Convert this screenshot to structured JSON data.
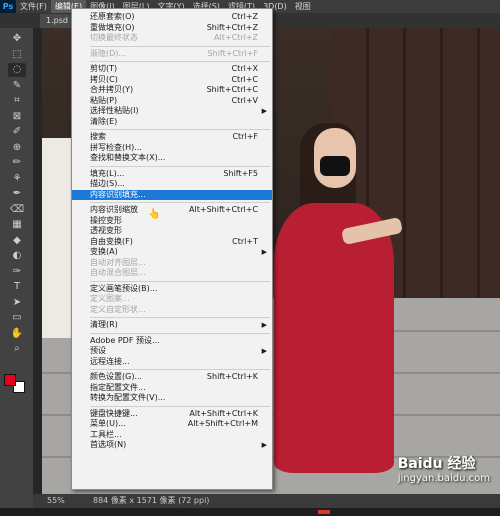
{
  "app": {
    "logo": "Ps"
  },
  "menubar": [
    {
      "label": "文件(F)",
      "active": false
    },
    {
      "label": "编辑(E)",
      "active": true
    },
    {
      "label": "图像(I)",
      "active": false
    },
    {
      "label": "图层(L)",
      "active": false
    },
    {
      "label": "文字(Y)",
      "active": false
    },
    {
      "label": "选择(S)",
      "active": false
    },
    {
      "label": "滤镜(T)",
      "active": false
    },
    {
      "label": "3D(D)",
      "active": false
    },
    {
      "label": "视图",
      "active": false
    }
  ],
  "document": {
    "tab": "1.psd"
  },
  "tools": [
    "move-icon",
    "marquee-icon",
    "lasso-icon",
    "quick-select-icon",
    "crop-icon",
    "frame-icon",
    "eyedropper-icon",
    "healing-icon",
    "brush-icon",
    "stamp-icon",
    "history-brush-icon",
    "eraser-icon",
    "gradient-icon",
    "blur-icon",
    "dodge-icon",
    "pen-icon",
    "type-icon",
    "path-select-icon",
    "shape-icon",
    "hand-icon",
    "zoom-icon"
  ],
  "colors": {
    "foreground": "#e8001c",
    "background": "#ffffff",
    "highlight": "#1c7ad6"
  },
  "edit_menu": [
    {
      "label": "还原套索(O)",
      "shortcut": "Ctrl+Z"
    },
    {
      "label": "重做填充(O)",
      "shortcut": "Shift+Ctrl+Z"
    },
    {
      "label": "切换最终状态",
      "shortcut": "Alt+Ctrl+Z",
      "disabled": true
    },
    {
      "sep": true
    },
    {
      "label": "渐隐(D)...",
      "shortcut": "Shift+Ctrl+F",
      "disabled": true
    },
    {
      "sep": true
    },
    {
      "label": "剪切(T)",
      "shortcut": "Ctrl+X"
    },
    {
      "label": "拷贝(C)",
      "shortcut": "Ctrl+C"
    },
    {
      "label": "合并拷贝(Y)",
      "shortcut": "Shift+Ctrl+C"
    },
    {
      "label": "粘贴(P)",
      "shortcut": "Ctrl+V"
    },
    {
      "label": "选择性粘贴(I)",
      "submenu": true
    },
    {
      "label": "清除(E)"
    },
    {
      "sep": true
    },
    {
      "label": "搜索",
      "shortcut": "Ctrl+F"
    },
    {
      "label": "拼写检查(H)..."
    },
    {
      "label": "查找和替换文本(X)..."
    },
    {
      "sep": true
    },
    {
      "label": "填充(L)...",
      "shortcut": "Shift+F5"
    },
    {
      "label": "描边(S)..."
    },
    {
      "label": "内容识别填充...",
      "highlighted": true
    },
    {
      "sep": true
    },
    {
      "label": "内容识别缩放",
      "shortcut": "Alt+Shift+Ctrl+C"
    },
    {
      "label": "操控变形"
    },
    {
      "label": "透视变形"
    },
    {
      "label": "自由变换(F)",
      "shortcut": "Ctrl+T"
    },
    {
      "label": "变换(A)",
      "submenu": true
    },
    {
      "label": "自动对齐图层...",
      "disabled": true
    },
    {
      "label": "自动混合图层...",
      "disabled": true
    },
    {
      "sep": true
    },
    {
      "label": "定义画笔预设(B)..."
    },
    {
      "label": "定义图案...",
      "disabled": true
    },
    {
      "label": "定义自定形状...",
      "disabled": true
    },
    {
      "sep": true
    },
    {
      "label": "清理(R)",
      "submenu": true
    },
    {
      "sep": true
    },
    {
      "label": "Adobe PDF 预设..."
    },
    {
      "label": "预设",
      "submenu": true
    },
    {
      "label": "远程连接..."
    },
    {
      "sep": true
    },
    {
      "label": "颜色设置(G)...",
      "shortcut": "Shift+Ctrl+K"
    },
    {
      "label": "指定配置文件..."
    },
    {
      "label": "转换为配置文件(V)..."
    },
    {
      "sep": true
    },
    {
      "label": "键盘快捷键...",
      "shortcut": "Alt+Shift+Ctrl+K"
    },
    {
      "label": "菜单(U)...",
      "shortcut": "Alt+Shift+Ctrl+M"
    },
    {
      "label": "工具栏..."
    },
    {
      "label": "首选项(N)",
      "submenu": true
    }
  ],
  "status": {
    "zoom": "55%",
    "info": "884 像素 x 1571 像素 (72 ppi)"
  },
  "watermark": {
    "title": "Baidu 经验",
    "url": "jingyan.baidu.com"
  }
}
